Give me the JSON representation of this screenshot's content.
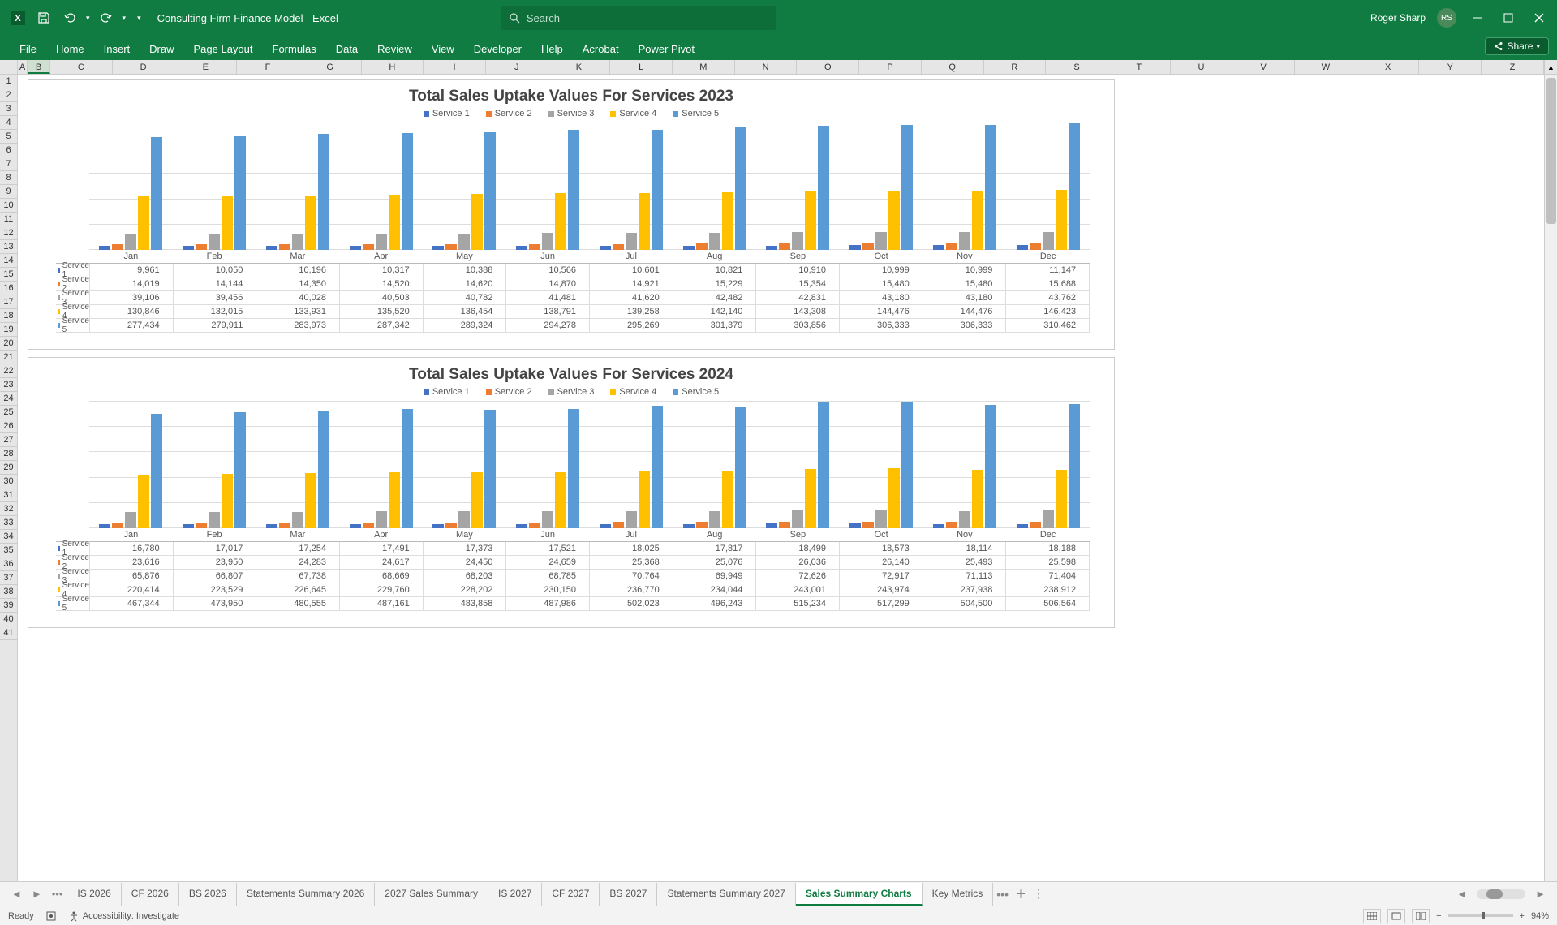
{
  "app": {
    "doc_title": "Consulting Firm Finance Model  -  Excel",
    "user_name": "Roger Sharp",
    "user_initials": "RS",
    "search_placeholder": "Search"
  },
  "ribbon": {
    "tabs": [
      "File",
      "Home",
      "Insert",
      "Draw",
      "Page Layout",
      "Formulas",
      "Data",
      "Review",
      "View",
      "Developer",
      "Help",
      "Acrobat",
      "Power Pivot"
    ],
    "share": "Share"
  },
  "columns": [
    "A",
    "B",
    "C",
    "D",
    "E",
    "F",
    "G",
    "H",
    "I",
    "J",
    "K",
    "L",
    "M",
    "N",
    "O",
    "P",
    "Q",
    "R",
    "S",
    "T",
    "U",
    "V",
    "W",
    "X",
    "Y",
    "Z"
  ],
  "row_count": 41,
  "chart_data": [
    {
      "title": "Total Sales Uptake Values For Services 2023",
      "type": "bar",
      "categories": [
        "Jan",
        "Feb",
        "Mar",
        "Apr",
        "May",
        "Jun",
        "Jul",
        "Aug",
        "Sep",
        "Oct",
        "Nov",
        "Dec"
      ],
      "legend": [
        "Service 1",
        "Service 2",
        "Service 3",
        "Service 4",
        "Service 5"
      ],
      "series": [
        {
          "name": "Service 1",
          "color": "#4472c4",
          "values": [
            9961,
            10050,
            10196,
            10317,
            10388,
            10566,
            10601,
            10821,
            10910,
            10999,
            10999,
            11147
          ]
        },
        {
          "name": "Service 2",
          "color": "#ed7d31",
          "values": [
            14019,
            14144,
            14350,
            14520,
            14620,
            14870,
            14921,
            15229,
            15354,
            15480,
            15480,
            15688
          ]
        },
        {
          "name": "Service 3",
          "color": "#a5a5a5",
          "values": [
            39106,
            39456,
            40028,
            40503,
            40782,
            41481,
            41620,
            42482,
            42831,
            43180,
            43180,
            43762
          ]
        },
        {
          "name": "Service 4",
          "color": "#ffc000",
          "values": [
            130846,
            132015,
            133931,
            135520,
            136454,
            138791,
            139258,
            142140,
            143308,
            144476,
            144476,
            146423
          ]
        },
        {
          "name": "Service 5",
          "color": "#5b9bd5",
          "values": [
            277434,
            279911,
            283973,
            287342,
            289324,
            294278,
            295269,
            301379,
            303856,
            306333,
            306333,
            310462
          ]
        }
      ],
      "ymax": 310462
    },
    {
      "title": "Total Sales Uptake Values For Services 2024",
      "type": "bar",
      "categories": [
        "Jan",
        "Feb",
        "Mar",
        "Apr",
        "May",
        "Jun",
        "Jul",
        "Aug",
        "Sep",
        "Oct",
        "Nov",
        "Dec"
      ],
      "legend": [
        "Service 1",
        "Service 2",
        "Service 3",
        "Service 4",
        "Service 5"
      ],
      "series": [
        {
          "name": "Service 1",
          "color": "#4472c4",
          "values": [
            16780,
            17017,
            17254,
            17491,
            17373,
            17521,
            18025,
            17817,
            18499,
            18573,
            18114,
            18188
          ]
        },
        {
          "name": "Service 2",
          "color": "#ed7d31",
          "values": [
            23616,
            23950,
            24283,
            24617,
            24450,
            24659,
            25368,
            25076,
            26036,
            26140,
            25493,
            25598
          ]
        },
        {
          "name": "Service 3",
          "color": "#a5a5a5",
          "values": [
            65876,
            66807,
            67738,
            68669,
            68203,
            68785,
            70764,
            69949,
            72626,
            72917,
            71113,
            71404
          ]
        },
        {
          "name": "Service 4",
          "color": "#ffc000",
          "values": [
            220414,
            223529,
            226645,
            229760,
            228202,
            230150,
            236770,
            234044,
            243001,
            243974,
            237938,
            238912
          ]
        },
        {
          "name": "Service 5",
          "color": "#5b9bd5",
          "values": [
            467344,
            473950,
            480555,
            487161,
            483858,
            487986,
            502023,
            496243,
            515234,
            517299,
            504500,
            506564
          ]
        }
      ],
      "ymax": 517299
    }
  ],
  "sheet_tabs": {
    "items": [
      "IS 2026",
      "CF 2026",
      "BS 2026",
      "Statements Summary 2026",
      "2027 Sales Summary",
      "IS 2027",
      "CF 2027",
      "BS 2027",
      "Statements Summary 2027",
      "Sales Summary Charts",
      "Key Metrics"
    ],
    "active": "Sales Summary Charts"
  },
  "status": {
    "ready": "Ready",
    "accessibility": "Accessibility: Investigate",
    "zoom": "94%"
  }
}
